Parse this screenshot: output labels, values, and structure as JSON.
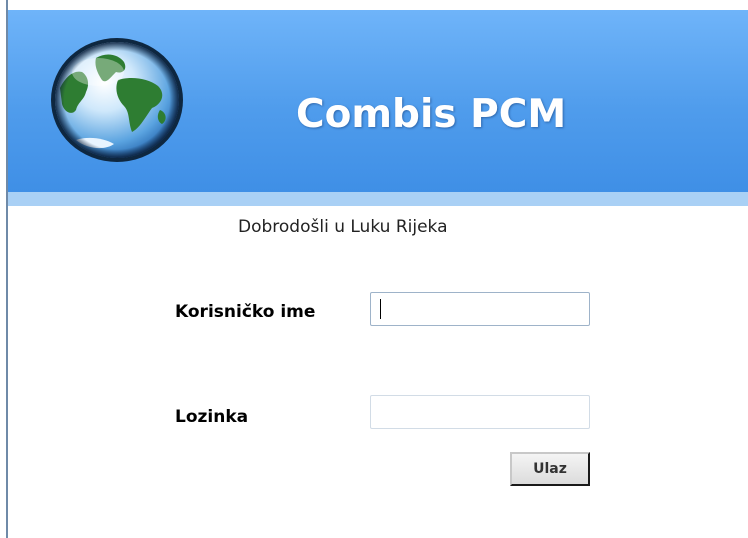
{
  "header": {
    "app_title": "Combis PCM",
    "logo_icon": "globe-icon"
  },
  "welcome_text": "Dobrodošli u Luku Rijeka",
  "login_form": {
    "username_label": "Korisničko ime",
    "username_value": "",
    "password_label": "Lozinka",
    "password_value": "",
    "submit_label": "Ulaz"
  },
  "colors": {
    "header_blue": "#4f9cec",
    "header_bottom": "#a9d0f5",
    "title_text": "#ffffff"
  }
}
